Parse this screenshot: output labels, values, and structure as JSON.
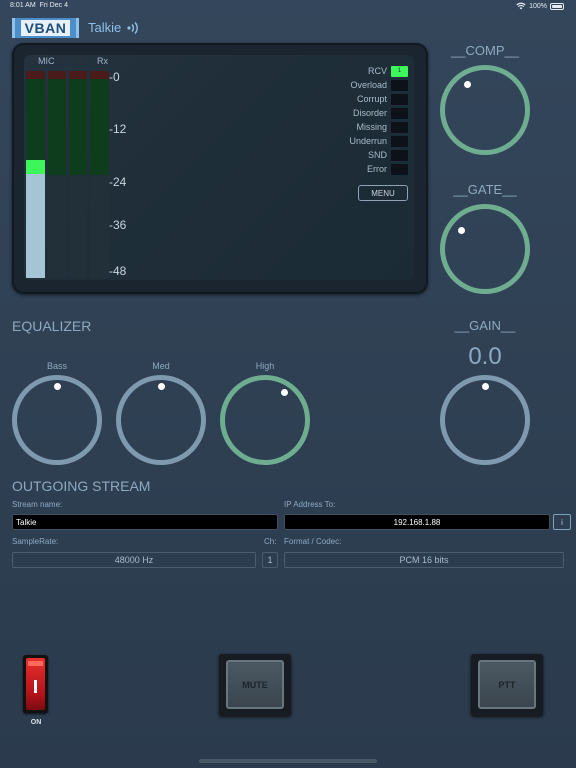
{
  "status_bar": {
    "time": "8:01 AM",
    "date": "Fri Dec 4",
    "battery": "100%",
    "icons": [
      "wifi-icon",
      "battery-icon"
    ]
  },
  "header": {
    "logo": "VBAN",
    "title": "Talkie",
    "icon": "broadcast-icon"
  },
  "monitor": {
    "meter_labels": [
      "MIC",
      "Rx"
    ],
    "scale": [
      "-0",
      "-12",
      "-24",
      "-36",
      "-48"
    ],
    "mic_level_fraction": 0.5,
    "status_items": [
      {
        "label": "RCV",
        "indicator": "1",
        "active": true
      },
      {
        "label": "Overload",
        "indicator": "",
        "active": false
      },
      {
        "label": "Corrupt",
        "indicator": "",
        "active": false
      },
      {
        "label": "Disorder",
        "indicator": "",
        "active": false
      },
      {
        "label": "Missing",
        "indicator": "",
        "active": false
      },
      {
        "label": "Underrun",
        "indicator": "",
        "active": false
      },
      {
        "label": "SND",
        "indicator": "",
        "active": false
      },
      {
        "label": "Error",
        "indicator": "",
        "active": false
      }
    ],
    "menu_label": "MENU"
  },
  "comp": {
    "title": "__COMP__"
  },
  "gate": {
    "title": "__GATE__"
  },
  "equalizer": {
    "title": "EQUALIZER",
    "bands": [
      {
        "label": "Bass"
      },
      {
        "label": "Med"
      },
      {
        "label": "High"
      }
    ]
  },
  "gain": {
    "title": "__GAIN__",
    "value": "0.0"
  },
  "outgoing": {
    "title": "OUTGOING STREAM",
    "stream_name_label": "Stream name:",
    "stream_name_value": "Talkie",
    "ip_label": "IP Address To:",
    "ip_value": "192.168.1.88",
    "info_label": "i",
    "samplerate_label": "SampleRate:",
    "samplerate_value": "48000 Hz",
    "ch_label": "Ch:",
    "ch_value": "1",
    "format_label": "Format / Codec:",
    "format_value": "PCM 16 bits"
  },
  "controls": {
    "power_label": "ON",
    "mute_label": "MUTE",
    "ptt_label": "PTT"
  },
  "colors": {
    "background": "#2e3f52",
    "knob_blue": "#7f9aaf",
    "knob_green": "#6fad91",
    "meter_peak": "#3df65a",
    "logo": "#4b8ec9"
  }
}
